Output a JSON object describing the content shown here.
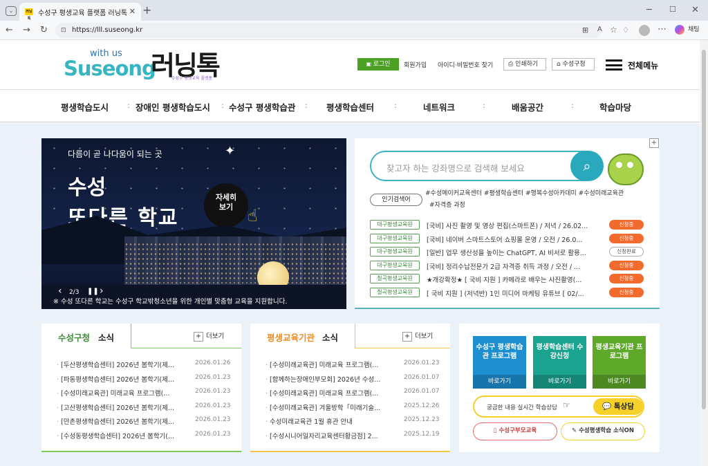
{
  "browser": {
    "tab_title": "수성구 평생교육 플랫폼 러닝톡",
    "tab_favicon": "러닝톡",
    "url": "https://lll.suseong.kr",
    "chat_label": "채팅"
  },
  "header": {
    "logo_with_us": "with us",
    "logo_suseong": "Suseong",
    "logo_learntalk": "러닝톡",
    "logo_sub": "수성구 평생교육 플랫폼",
    "login": "로그인",
    "join": "회원가입",
    "find": "아이디·비밀번호 찾기",
    "print": "인쇄하기",
    "gu_office": "수성구청",
    "all_menu": "전체메뉴"
  },
  "gnb": [
    "평생학습도시",
    "장애인 평생학습도시",
    "수성구 평생학습관",
    "평생학습센터",
    "네트워크",
    "배움공간",
    "학습마당"
  ],
  "slide": {
    "tagline": "다름이 곧 나다움이 되는 곳",
    "title_line1": "수성",
    "title_line2": "또다른 학교",
    "more_line1": "자세히",
    "more_line2": "보기",
    "pager": "2/3",
    "caption": "※ 수성 또다른 학교는 수성구 학교밖청소년을 위한 개인별 맞춤형 교육을 지원합니다."
  },
  "search": {
    "placeholder": "찾고자 하는 강좌명으로 검색해 보세요",
    "popular_label": "인기검색어",
    "keywords_line1": "#수성메이커교육센터 #평생학습센터 #행복수성아카데미 #수성미래교육관",
    "keywords_line2": "#자격증 과정"
  },
  "courses": [
    {
      "org": "대구평생교육원",
      "title": "[국비] 사진 촬영 및 영상 편집(스마트폰) / 저녁 / 26.02...",
      "status": "신청중",
      "state": "open"
    },
    {
      "org": "대구평생교육원",
      "title": "[국비] 네이버 스마트스토어 쇼핑몰 운영 / 오전 / 26.0...",
      "status": "신청중",
      "state": "open"
    },
    {
      "org": "대구평생교육원",
      "title": "[일반] 업무 생산성을 높이는 ChatGPT, AI 비서로 활용...",
      "status": "신청완료",
      "state": "closed"
    },
    {
      "org": "대구평생교육원",
      "title": "[국비] 정리수납전문가 2급 자격증 취득 과정 / 오전 / ...",
      "status": "신청중",
      "state": "open"
    },
    {
      "org": "칠곡평생교육원",
      "title": "★개강확정★ [ 국비 지원 ] 카메라로 배우는 사진촬영(...",
      "status": "신청중",
      "state": "open"
    },
    {
      "org": "칠곡평생교육원",
      "title": "[ 국비 지원 ] (저녁반) 1인 미디어 마케팅 유튜브 [ 02/...",
      "status": "신청중",
      "state": "open"
    }
  ],
  "news_gu": {
    "title_accent": "수성구청",
    "title_rest": "소식",
    "more": "더보기",
    "items": [
      {
        "title": "[두산평생학습센터] 2026년 봄학기(제...",
        "date": "2026.01.26"
      },
      {
        "title": "[파동평생학습센터] 2026년 봄학기(제...",
        "date": "2026.01.23"
      },
      {
        "title": "[수성미래교육관] 미래교육 프로그램(...",
        "date": "2026.01.23"
      },
      {
        "title": "[고산평생학습센터] 2026년 봄학기(제...",
        "date": "2026.01.23"
      },
      {
        "title": "[만촌평생학습센터] 2026년 봄학기(제...",
        "date": "2026.01.23"
      },
      {
        "title": "[수성동평생학습센터] 2026년 봄학기(...",
        "date": "2026.01.23"
      }
    ]
  },
  "news_org": {
    "title_accent": "평생교육기관",
    "title_rest": "소식",
    "more": "더보기",
    "items": [
      {
        "title": "[수성미래교육관] 미래교육 프로그램(...",
        "date": "2026.01.23"
      },
      {
        "title": "[함께하는장애인부모회] 2026년 수성...",
        "date": "2026.01.07"
      },
      {
        "title": "[수성미래교육관] 미래교육 프로그램(...",
        "date": "2026.01.07"
      },
      {
        "title": "[수성미래교육관] 겨울방학「미래기술...",
        "date": "2025.12.26"
      },
      {
        "title": "수성미래교육관 1월 휴관 안내",
        "date": "2025.12.23"
      },
      {
        "title": "[수성시니어일자리교육센터황금점] 2...",
        "date": "2025.12.19"
      }
    ]
  },
  "quick": [
    {
      "title": "수성구 평생학습관 프로그램",
      "go": "바로가기",
      "color": "#1d8fd1"
    },
    {
      "title": "평생학습센터 수강신청",
      "go": "바로가기",
      "color": "#1aa38f"
    },
    {
      "title": "평생교육기관 프로그램",
      "go": "바로가기",
      "color": "#5ea82a"
    }
  ],
  "kakao": {
    "text": "궁금한 내용 실시간 학습상담",
    "button": "톡상담"
  },
  "links": {
    "parent_edu": "수성구부모교육",
    "news_on": "수성평생학습 소식ON"
  }
}
